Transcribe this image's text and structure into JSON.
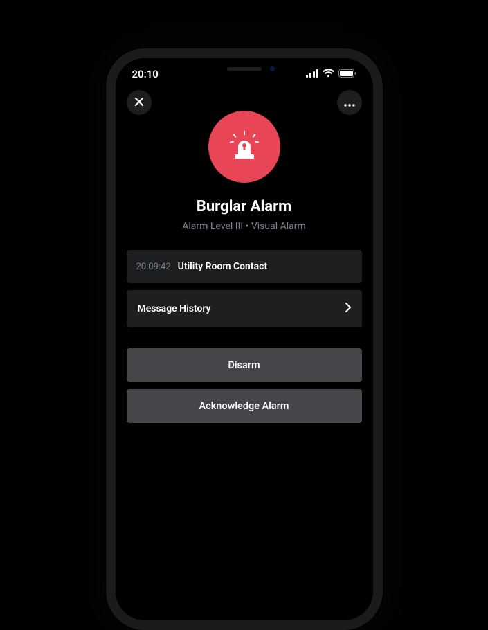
{
  "statusbar": {
    "time": "20:10"
  },
  "alarm": {
    "title": "Burglar Alarm",
    "subtitle": "Alarm Level III • Visual Alarm",
    "icon_color": "#e84656"
  },
  "event": {
    "time": "20:09:42",
    "text": "Utility Room Contact"
  },
  "links": {
    "history": "Message History"
  },
  "actions": {
    "disarm": "Disarm",
    "acknowledge": "Acknowledge Alarm"
  }
}
